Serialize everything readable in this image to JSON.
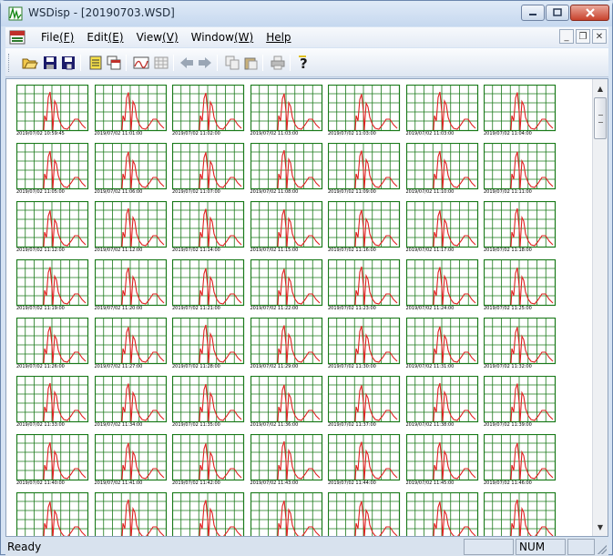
{
  "window": {
    "title": "WSDisp - [20190703.WSD]"
  },
  "menu": {
    "items": [
      {
        "label": "File",
        "accel": "(F)"
      },
      {
        "label": "Edit",
        "accel": "(E)"
      },
      {
        "label": "View",
        "accel": "(V)"
      },
      {
        "label": "Window",
        "accel": "(W)"
      },
      {
        "label": "Help",
        "accel": ""
      }
    ]
  },
  "toolbar": {
    "buttons": [
      "open-icon",
      "save-icon",
      "save-all-icon",
      "new-doc-icon",
      "copy-window-icon",
      "graph-icon",
      "grid-icon",
      "back-arrow-icon",
      "forward-arrow-icon",
      "copy-icon",
      "paste-icon",
      "print-icon",
      "help-icon"
    ]
  },
  "thumbnails": {
    "labels": [
      "2019/07/02 10:59:45",
      "2019/07/02 11:01:00",
      "2019/07/02 11:02:00",
      "2019/07/02 11:03:00",
      "2019/07/02 11:03:00",
      "2019/07/02 11:03:00",
      "2019/07/02 11:04:00",
      "2019/07/02 11:05:00",
      "2019/07/02 11:06:00",
      "2019/07/02 11:07:00",
      "2019/07/02 11:08:00",
      "2019/07/02 11:09:00",
      "2019/07/02 11:10:00",
      "2019/07/02 11:11:00",
      "2019/07/02 11:12:00",
      "2019/07/02 11:12:00",
      "2019/07/02 11:14:00",
      "2019/07/02 11:15:00",
      "2019/07/02 11:16:00",
      "2019/07/02 11:17:00",
      "2019/07/02 11:18:00",
      "2019/07/02 11:19:00",
      "2019/07/02 11:20:00",
      "2019/07/02 11:21:00",
      "2019/07/02 11:22:00",
      "2019/07/02 11:23:00",
      "2019/07/02 11:24:00",
      "2019/07/02 11:25:00",
      "2019/07/02 11:26:00",
      "2019/07/02 11:27:00",
      "2019/07/02 11:28:00",
      "2019/07/02 11:29:00",
      "2019/07/02 11:30:00",
      "2019/07/02 11:31:00",
      "2019/07/02 11:32:00",
      "2019/07/02 11:33:00",
      "2019/07/02 11:34:00",
      "2019/07/02 11:35:00",
      "2019/07/02 11:36:00",
      "2019/07/02 11:37:00",
      "2019/07/02 11:38:00",
      "2019/07/02 11:39:00",
      "2019/07/02 11:40:00",
      "2019/07/02 11:41:00",
      "2019/07/02 11:42:00",
      "2019/07/02 11:43:00",
      "2019/07/02 11:44:00",
      "2019/07/02 11:45:00",
      "2019/07/02 11:46:00",
      "",
      "",
      "",
      "",
      "",
      "",
      ""
    ],
    "colors": {
      "grid": "#1a7a1a",
      "trace": "#e02020"
    }
  },
  "status": {
    "text": "Ready",
    "num": "NUM"
  }
}
